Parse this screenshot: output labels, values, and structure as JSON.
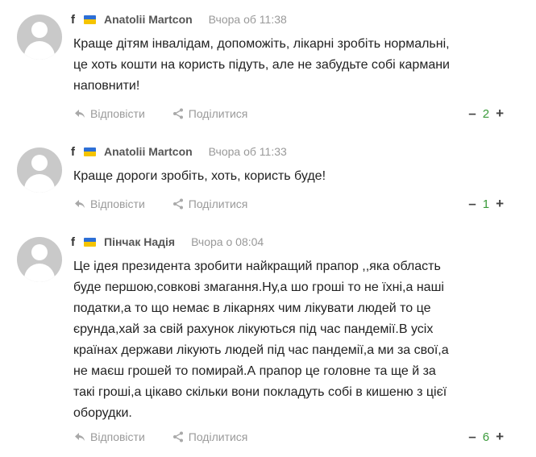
{
  "comments": [
    {
      "fb_glyph": "f",
      "author": "Anatolii Martcon",
      "time": "Вчора об 11:38",
      "text": "Краще дітям інвалідам, допоможіть, лікарні зробіть нормальні,\nце хоть кошти на користь підуть, але не забудьте собі кармани\nнаповнити!",
      "reply_label": "Відповісти",
      "share_label": "Поділитися",
      "votes_minus": "–",
      "votes": "2",
      "votes_plus": "+"
    },
    {
      "fb_glyph": "f",
      "author": "Anatolii Martcon",
      "time": "Вчора об 11:33",
      "text": "Краще дороги зробіть, хоть, користь буде!",
      "reply_label": "Відповісти",
      "share_label": "Поділитися",
      "votes_minus": "–",
      "votes": "1",
      "votes_plus": "+"
    },
    {
      "fb_glyph": "f",
      "author": "Пінчак Надія",
      "time": "Вчора о 08:04",
      "text": "Це ідея президента зробити найкращий прапор ,,яка область\nбуде першою,совкові змагання.Ну,а шо гроші то не їхні,а наші\nподатки,а то що немає в лікарнях чим лікувати людей то це\nєрунда,хай за свій рахунок лікуються під час пандемії.В усіх\nкраїнах держави лікують людей під час пандемії,а ми за свої,а\nне маєш грошей то помирай.А прапор це головне та ще й за\nтакі гроші,а цікаво скільки вони покладуть собі в кишеню з цієї\nоборудки.",
      "reply_label": "Відповісти",
      "share_label": "Поділитися",
      "votes_minus": "–",
      "votes": "6",
      "votes_plus": "+"
    }
  ],
  "colors": {
    "flag_blue": "#2d6fd6",
    "flag_yellow": "#f5c400",
    "vote_count": "#3a9a3a",
    "muted": "#9a9a9a"
  },
  "icons": {
    "reply": "reply-arrow-icon",
    "share": "share-icon",
    "avatar": "default-user-avatar"
  }
}
